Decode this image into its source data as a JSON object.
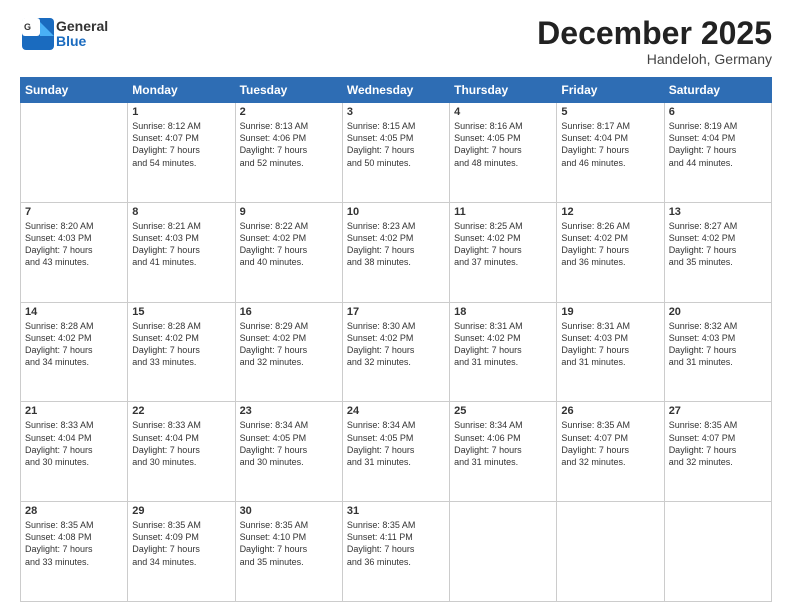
{
  "header": {
    "logo": {
      "line1": "General",
      "line2": "Blue"
    },
    "title": "December 2025",
    "subtitle": "Handeloh, Germany"
  },
  "days_of_week": [
    "Sunday",
    "Monday",
    "Tuesday",
    "Wednesday",
    "Thursday",
    "Friday",
    "Saturday"
  ],
  "weeks": [
    [
      {
        "num": "",
        "info": ""
      },
      {
        "num": "1",
        "info": "Sunrise: 8:12 AM\nSunset: 4:07 PM\nDaylight: 7 hours\nand 54 minutes."
      },
      {
        "num": "2",
        "info": "Sunrise: 8:13 AM\nSunset: 4:06 PM\nDaylight: 7 hours\nand 52 minutes."
      },
      {
        "num": "3",
        "info": "Sunrise: 8:15 AM\nSunset: 4:05 PM\nDaylight: 7 hours\nand 50 minutes."
      },
      {
        "num": "4",
        "info": "Sunrise: 8:16 AM\nSunset: 4:05 PM\nDaylight: 7 hours\nand 48 minutes."
      },
      {
        "num": "5",
        "info": "Sunrise: 8:17 AM\nSunset: 4:04 PM\nDaylight: 7 hours\nand 46 minutes."
      },
      {
        "num": "6",
        "info": "Sunrise: 8:19 AM\nSunset: 4:04 PM\nDaylight: 7 hours\nand 44 minutes."
      }
    ],
    [
      {
        "num": "7",
        "info": "Sunrise: 8:20 AM\nSunset: 4:03 PM\nDaylight: 7 hours\nand 43 minutes."
      },
      {
        "num": "8",
        "info": "Sunrise: 8:21 AM\nSunset: 4:03 PM\nDaylight: 7 hours\nand 41 minutes."
      },
      {
        "num": "9",
        "info": "Sunrise: 8:22 AM\nSunset: 4:02 PM\nDaylight: 7 hours\nand 40 minutes."
      },
      {
        "num": "10",
        "info": "Sunrise: 8:23 AM\nSunset: 4:02 PM\nDaylight: 7 hours\nand 38 minutes."
      },
      {
        "num": "11",
        "info": "Sunrise: 8:25 AM\nSunset: 4:02 PM\nDaylight: 7 hours\nand 37 minutes."
      },
      {
        "num": "12",
        "info": "Sunrise: 8:26 AM\nSunset: 4:02 PM\nDaylight: 7 hours\nand 36 minutes."
      },
      {
        "num": "13",
        "info": "Sunrise: 8:27 AM\nSunset: 4:02 PM\nDaylight: 7 hours\nand 35 minutes."
      }
    ],
    [
      {
        "num": "14",
        "info": "Sunrise: 8:28 AM\nSunset: 4:02 PM\nDaylight: 7 hours\nand 34 minutes."
      },
      {
        "num": "15",
        "info": "Sunrise: 8:28 AM\nSunset: 4:02 PM\nDaylight: 7 hours\nand 33 minutes."
      },
      {
        "num": "16",
        "info": "Sunrise: 8:29 AM\nSunset: 4:02 PM\nDaylight: 7 hours\nand 32 minutes."
      },
      {
        "num": "17",
        "info": "Sunrise: 8:30 AM\nSunset: 4:02 PM\nDaylight: 7 hours\nand 32 minutes."
      },
      {
        "num": "18",
        "info": "Sunrise: 8:31 AM\nSunset: 4:02 PM\nDaylight: 7 hours\nand 31 minutes."
      },
      {
        "num": "19",
        "info": "Sunrise: 8:31 AM\nSunset: 4:03 PM\nDaylight: 7 hours\nand 31 minutes."
      },
      {
        "num": "20",
        "info": "Sunrise: 8:32 AM\nSunset: 4:03 PM\nDaylight: 7 hours\nand 31 minutes."
      }
    ],
    [
      {
        "num": "21",
        "info": "Sunrise: 8:33 AM\nSunset: 4:04 PM\nDaylight: 7 hours\nand 30 minutes."
      },
      {
        "num": "22",
        "info": "Sunrise: 8:33 AM\nSunset: 4:04 PM\nDaylight: 7 hours\nand 30 minutes."
      },
      {
        "num": "23",
        "info": "Sunrise: 8:34 AM\nSunset: 4:05 PM\nDaylight: 7 hours\nand 30 minutes."
      },
      {
        "num": "24",
        "info": "Sunrise: 8:34 AM\nSunset: 4:05 PM\nDaylight: 7 hours\nand 31 minutes."
      },
      {
        "num": "25",
        "info": "Sunrise: 8:34 AM\nSunset: 4:06 PM\nDaylight: 7 hours\nand 31 minutes."
      },
      {
        "num": "26",
        "info": "Sunrise: 8:35 AM\nSunset: 4:07 PM\nDaylight: 7 hours\nand 32 minutes."
      },
      {
        "num": "27",
        "info": "Sunrise: 8:35 AM\nSunset: 4:07 PM\nDaylight: 7 hours\nand 32 minutes."
      }
    ],
    [
      {
        "num": "28",
        "info": "Sunrise: 8:35 AM\nSunset: 4:08 PM\nDaylight: 7 hours\nand 33 minutes."
      },
      {
        "num": "29",
        "info": "Sunrise: 8:35 AM\nSunset: 4:09 PM\nDaylight: 7 hours\nand 34 minutes."
      },
      {
        "num": "30",
        "info": "Sunrise: 8:35 AM\nSunset: 4:10 PM\nDaylight: 7 hours\nand 35 minutes."
      },
      {
        "num": "31",
        "info": "Sunrise: 8:35 AM\nSunset: 4:11 PM\nDaylight: 7 hours\nand 36 minutes."
      },
      {
        "num": "",
        "info": ""
      },
      {
        "num": "",
        "info": ""
      },
      {
        "num": "",
        "info": ""
      }
    ]
  ]
}
